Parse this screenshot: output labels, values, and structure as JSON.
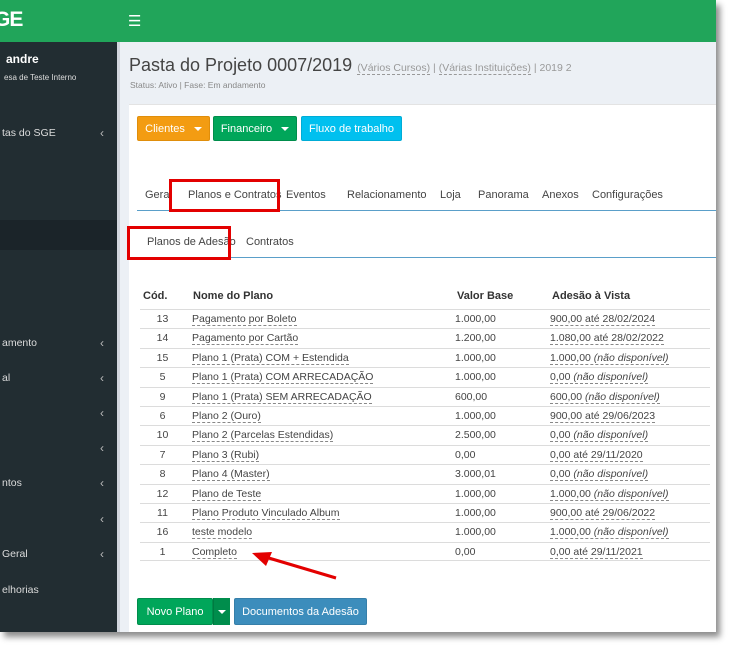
{
  "app": {
    "logo": "GE"
  },
  "topbar": {
    "menu_icon": "hamburger-icon"
  },
  "sidebar": {
    "user_name": "andre",
    "user_sub": "esa de Teste Interno",
    "items": [
      {
        "label": "tas do SGE",
        "chevron": "‹"
      },
      {
        "label": "amento",
        "chevron": "‹"
      },
      {
        "label": "al",
        "chevron": "‹"
      },
      {
        "label": "",
        "chevron": "‹"
      },
      {
        "label": "",
        "chevron": "‹"
      },
      {
        "label": "ntos",
        "chevron": "‹"
      },
      {
        "label": "",
        "chevron": "‹"
      },
      {
        "label": "Geral",
        "chevron": "‹"
      },
      {
        "label": "elhorias",
        "chevron": ""
      }
    ]
  },
  "header": {
    "title": "Pasta do Projeto 0007/2019",
    "link_cursos": "(Vários Cursos)",
    "link_instituicoes": "(Várias Instituições)",
    "sep1": "|",
    "sep2": "|",
    "period": "2019 2",
    "status": "Status: Ativo | Fase: Em andamento"
  },
  "toolbar": {
    "clientes": "Clientes",
    "financeiro": "Financeiro",
    "fluxo": "Fluxo de trabalho"
  },
  "tabs": [
    "Geral",
    "Planos e Contratos",
    "Eventos",
    "Relacionamento",
    "Loja",
    "Panorama",
    "Anexos",
    "Configurações"
  ],
  "subtabs": [
    "Planos de Adesão",
    "Contratos"
  ],
  "table": {
    "headers": {
      "cod": "Cód.",
      "nome": "Nome do Plano",
      "valor": "Valor Base",
      "adesao": "Adesão à Vista"
    },
    "rows": [
      {
        "cod": "13",
        "nome": "Pagamento por Boleto",
        "valor": "1.000,00",
        "adesao": "900,00 até 28/02/2024",
        "nd": ""
      },
      {
        "cod": "14",
        "nome": "Pagamento por Cartão",
        "valor": "1.200,00",
        "adesao": "1.080,00 até 28/02/2022",
        "nd": ""
      },
      {
        "cod": "15",
        "nome": "Plano 1 (Prata) COM + Estendida",
        "valor": "1.000,00",
        "adesao": "1.000,00 ",
        "nd": "(não disponível)"
      },
      {
        "cod": "5",
        "nome": "Plano 1 (Prata) COM ARRECADAÇÃO",
        "valor": "1.000,00",
        "adesao": "0,00 ",
        "nd": "(não disponível)"
      },
      {
        "cod": "9",
        "nome": "Plano 1 (Prata) SEM ARRECADAÇÃO",
        "valor": "600,00",
        "adesao": "600,00 ",
        "nd": "(não disponível)"
      },
      {
        "cod": "6",
        "nome": "Plano 2 (Ouro)",
        "valor": "1.000,00",
        "adesao": "900,00 até 29/06/2023",
        "nd": ""
      },
      {
        "cod": "10",
        "nome": "Plano 2 (Parcelas Estendidas)",
        "valor": "2.500,00",
        "adesao": "0,00 ",
        "nd": "(não disponível)"
      },
      {
        "cod": "7",
        "nome": "Plano 3 (Rubi)",
        "valor": "0,00",
        "adesao": "0,00 até 29/11/2020",
        "nd": ""
      },
      {
        "cod": "8",
        "nome": "Plano 4 (Master)",
        "valor": "3.000,01",
        "adesao": "0,00 ",
        "nd": "(não disponível)"
      },
      {
        "cod": "12",
        "nome": "Plano de Teste",
        "valor": "1.000,00",
        "adesao": "1.000,00 ",
        "nd": "(não disponível)"
      },
      {
        "cod": "11",
        "nome": "Plano Produto Vinculado Album",
        "valor": "1.000,00",
        "adesao": "900,00 até 29/06/2022",
        "nd": ""
      },
      {
        "cod": "16",
        "nome": "teste modelo",
        "valor": "1.000,00",
        "adesao": "1.000,00 ",
        "nd": "(não disponível)"
      },
      {
        "cod": "1",
        "nome": "Completo",
        "valor": "0,00",
        "adesao": "0,00 até 29/11/2021",
        "nd": ""
      }
    ]
  },
  "footer": {
    "novo_plano": "Novo Plano",
    "documentos": "Documentos da Adesão"
  },
  "colors": {
    "brand_green": "#21a55a",
    "highlight_red": "#e30000",
    "sidebar_bg": "#222d32"
  }
}
